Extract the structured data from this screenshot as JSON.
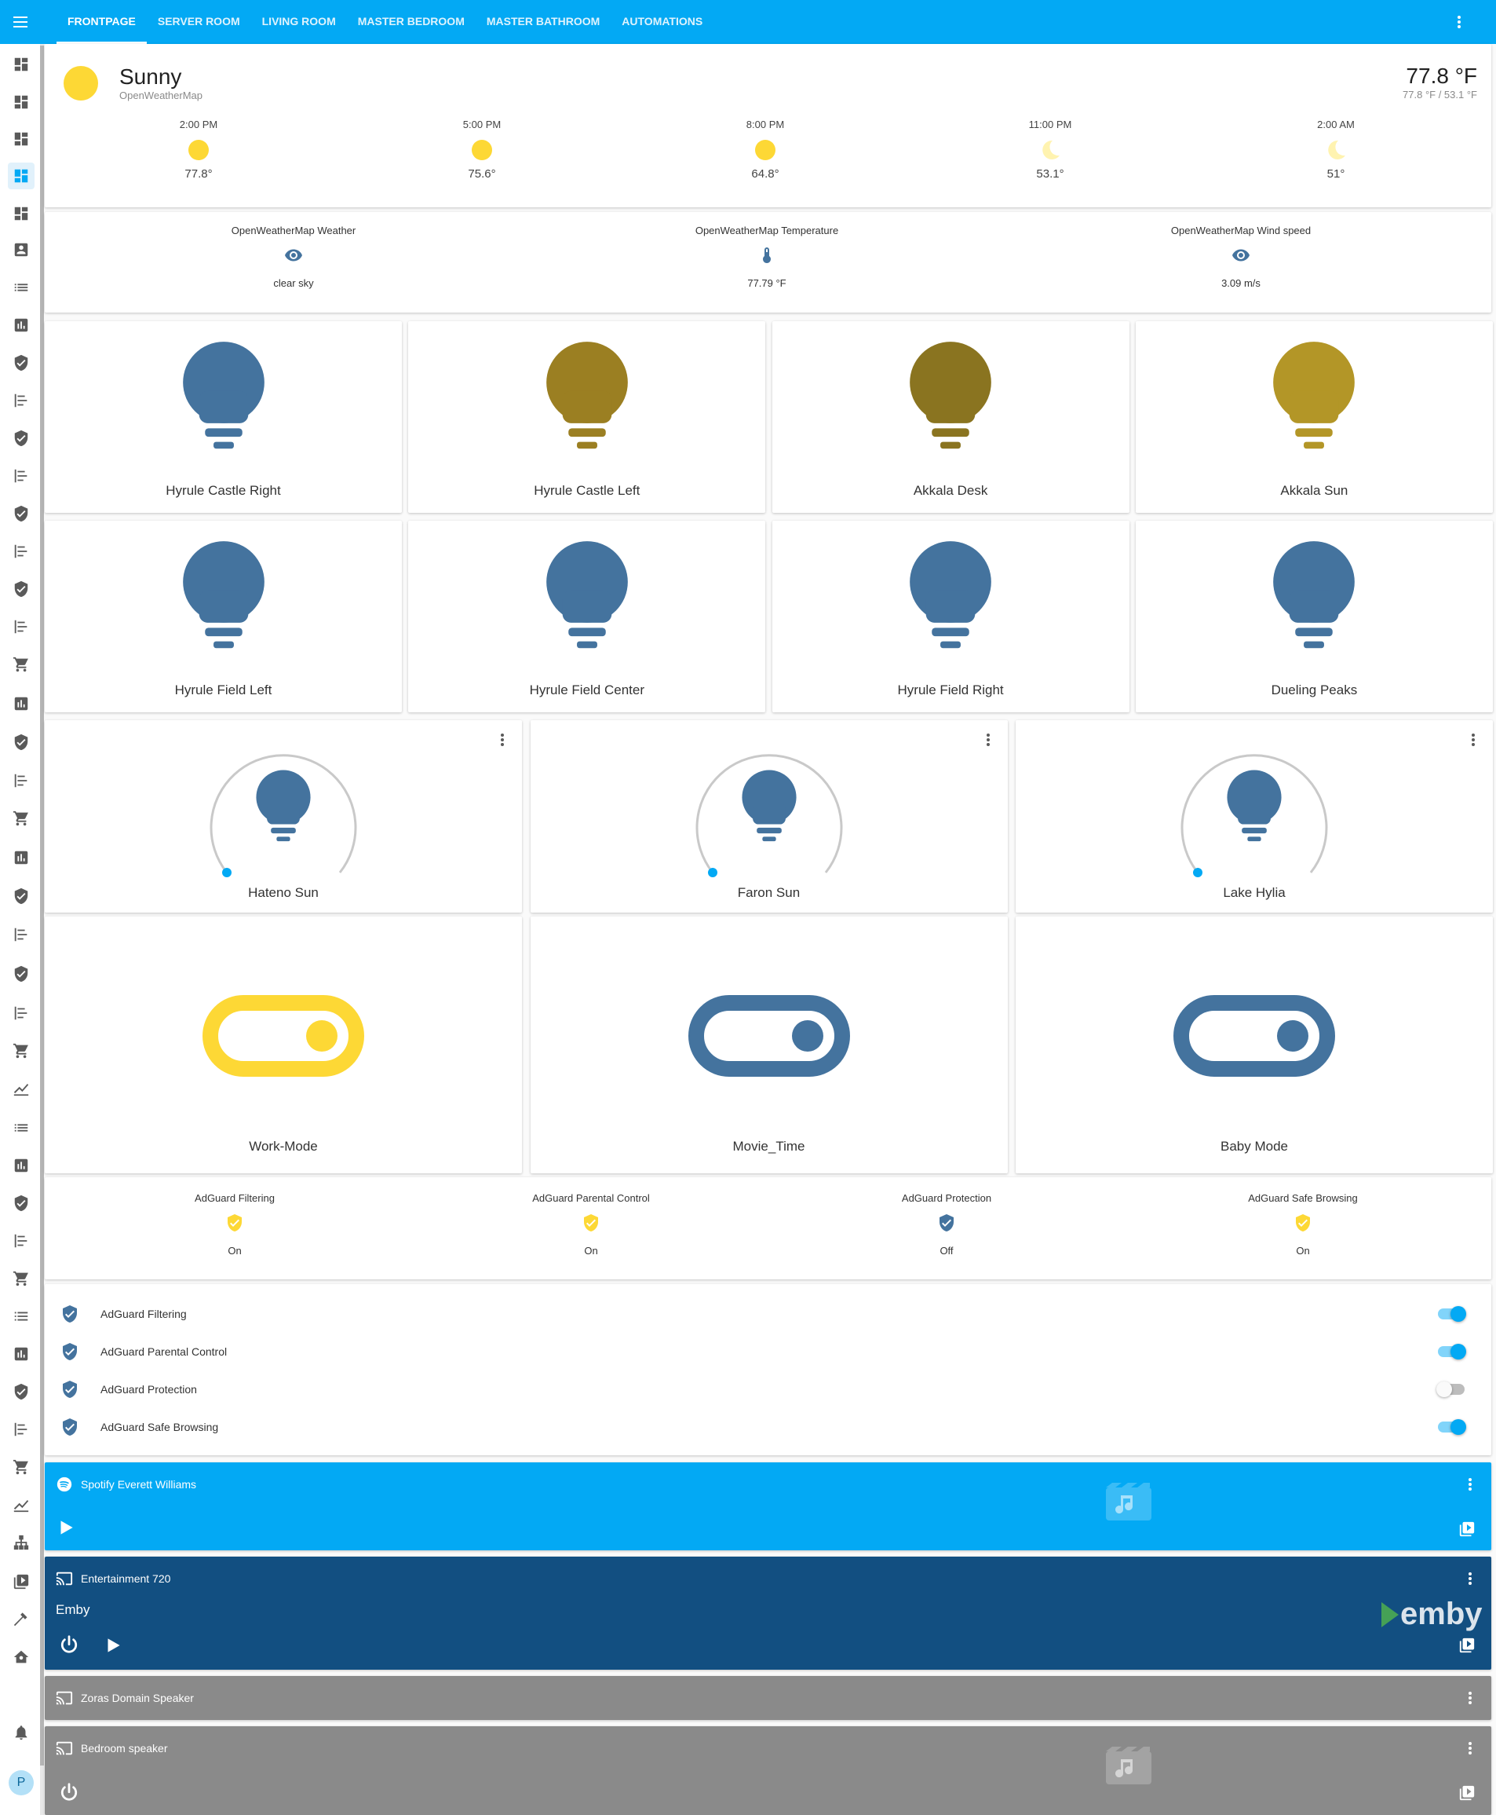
{
  "top_bar": {
    "tabs": [
      "FRONTPAGE",
      "SERVER ROOM",
      "LIVING ROOM",
      "MASTER BEDROOM",
      "MASTER BATHROOM",
      "AUTOMATIONS"
    ]
  },
  "sidebar": {
    "avatar_initial": "P",
    "icons": [
      "dashboard-icon",
      "dashboard-icon",
      "dashboard-icon",
      "dashboard-icon",
      "dashboard-icon",
      "account-box-icon",
      "list-icon",
      "chart-icon",
      "shield-check-icon",
      "timeline-icon",
      "shield-check-icon",
      "timeline-icon",
      "shield-check-icon",
      "timeline-icon",
      "shield-check-icon",
      "timeline-icon",
      "cart-icon",
      "chart-icon",
      "shield-check-icon",
      "timeline-icon",
      "cart-icon",
      "chart-icon",
      "shield-check-icon",
      "timeline-icon",
      "shield-check-icon",
      "timeline-icon",
      "cart-icon",
      "line-chart-icon",
      "list-icon",
      "chart-icon",
      "shield-check-icon",
      "timeline-icon",
      "cart-icon",
      "list-check-icon",
      "chart-icon",
      "shield-check-icon",
      "timeline-icon",
      "cart-icon",
      "line-chart-icon",
      "sitemap-icon",
      "media-library-icon",
      "hammer-icon",
      "home-settings-icon",
      "bell-icon"
    ]
  },
  "weather": {
    "condition": "Sunny",
    "source": "OpenWeatherMap",
    "temp": "77.8 °F",
    "hi_lo": "77.8 °F / 53.1 °F",
    "forecast": [
      {
        "time": "2:00 PM",
        "icon": "sun-icon",
        "temp": "77.8°"
      },
      {
        "time": "5:00 PM",
        "icon": "sun-icon",
        "temp": "75.6°"
      },
      {
        "time": "8:00 PM",
        "icon": "sun-icon",
        "temp": "64.8°"
      },
      {
        "time": "11:00 PM",
        "icon": "moon-icon",
        "temp": "53.1°"
      },
      {
        "time": "2:00 AM",
        "icon": "moon-icon",
        "temp": "51°"
      }
    ]
  },
  "sensors": [
    {
      "name": "OpenWeatherMap Weather",
      "icon": "eye-icon",
      "value": "clear sky"
    },
    {
      "name": "OpenWeatherMap Temperature",
      "icon": "thermometer-icon",
      "value": "77.79 °F"
    },
    {
      "name": "OpenWeatherMap Wind speed",
      "icon": "eye-icon",
      "value": "3.09 m/s"
    }
  ],
  "lights_row1": [
    {
      "name": "Hyrule Castle Right",
      "color": "#44739e"
    },
    {
      "name": "Hyrule Castle Left",
      "color": "#9b7f22"
    },
    {
      "name": "Akkala Desk",
      "color": "#8a7420"
    },
    {
      "name": "Akkala Sun",
      "color": "#b39627"
    }
  ],
  "lights_row2": [
    {
      "name": "Hyrule Field Left",
      "color": "#44739e"
    },
    {
      "name": "Hyrule Field Center",
      "color": "#44739e"
    },
    {
      "name": "Hyrule Field Right",
      "color": "#44739e"
    },
    {
      "name": "Dueling Peaks",
      "color": "#44739e"
    }
  ],
  "dimmers": [
    {
      "name": "Hateno Sun",
      "brightness": 0
    },
    {
      "name": "Faron Sun",
      "brightness": 0
    },
    {
      "name": "Lake Hylia",
      "brightness": 0
    }
  ],
  "switches": [
    {
      "name": "Work-Mode",
      "on": true,
      "color": "#fdd835"
    },
    {
      "name": "Movie_Time",
      "on": true,
      "color": "#44739e"
    },
    {
      "name": "Baby Mode",
      "on": true,
      "color": "#44739e"
    }
  ],
  "adguard_glance": [
    {
      "name": "AdGuard Filtering",
      "state": "On",
      "color": "#fdd835"
    },
    {
      "name": "AdGuard Parental Control",
      "state": "On",
      "color": "#fdd835"
    },
    {
      "name": "AdGuard Protection",
      "state": "Off",
      "color": "#44739e"
    },
    {
      "name": "AdGuard Safe Browsing",
      "state": "On",
      "color": "#fdd835"
    }
  ],
  "adguard_toggles": [
    {
      "name": "AdGuard Filtering",
      "on": true
    },
    {
      "name": "AdGuard Parental Control",
      "on": true
    },
    {
      "name": "AdGuard Protection",
      "on": false
    },
    {
      "name": "AdGuard Safe Browsing",
      "on": true
    }
  ],
  "media": [
    {
      "title": "Spotify Everett Williams",
      "subtitle": "",
      "color": "#03a9f4",
      "icon": "spotify-icon"
    },
    {
      "title": "Entertainment 720",
      "subtitle": "Emby",
      "color": "#124f81",
      "icon": "cast-icon",
      "logo": "emby"
    },
    {
      "title": "Zoras Domain Speaker",
      "subtitle": "",
      "color": "#8a8a8a",
      "icon": "cast-icon"
    },
    {
      "title": "Bedroom speaker",
      "subtitle": "",
      "color": "#8a8a8a",
      "icon": "cast-icon"
    }
  ],
  "colors": {
    "accent": "#03a9f4",
    "on": "#fdd835",
    "off": "#44739e"
  }
}
